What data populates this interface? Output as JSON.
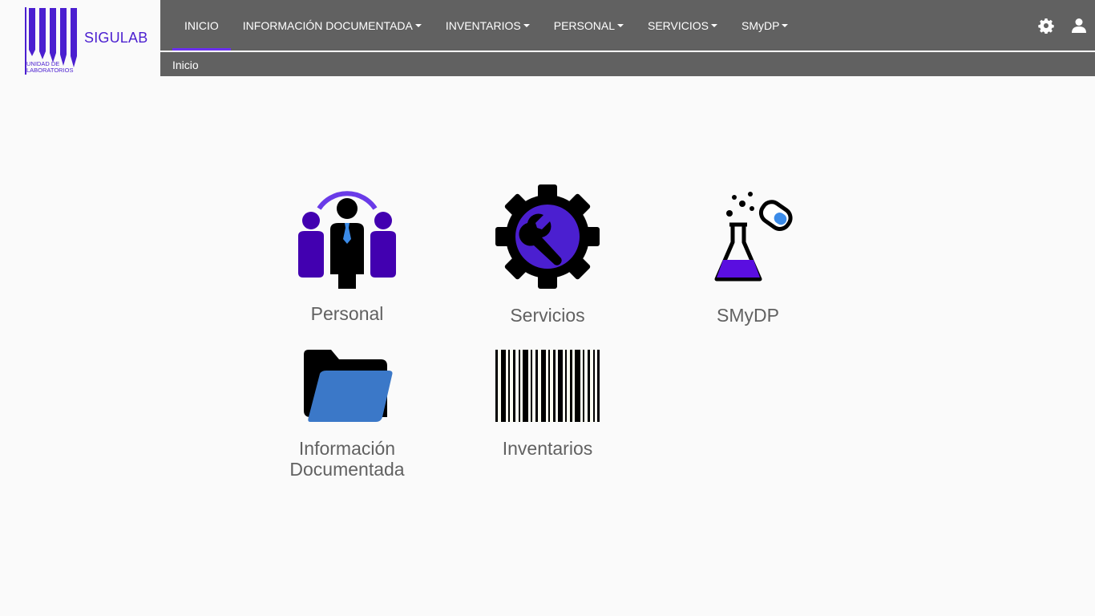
{
  "brand": {
    "name": "SIGULAB",
    "subtitle": "UNIDAD DE LABORATORIOS",
    "color": "#4b1fd0"
  },
  "nav": {
    "items": [
      {
        "label": "INICIO",
        "active": true,
        "dropdown": false
      },
      {
        "label": "INFORMACIÓN DOCUMENTADA",
        "active": false,
        "dropdown": true
      },
      {
        "label": "INVENTARIOS",
        "active": false,
        "dropdown": true
      },
      {
        "label": "PERSONAL",
        "active": false,
        "dropdown": true
      },
      {
        "label": "SERVICIOS",
        "active": false,
        "dropdown": true
      },
      {
        "label": "SMyDP",
        "active": false,
        "dropdown": true
      }
    ],
    "icons": [
      "gear-icon",
      "user-icon"
    ],
    "background": "#616161",
    "accent": "#6b2ff0"
  },
  "breadcrumb": {
    "current": "Inicio"
  },
  "tiles": {
    "personal": {
      "label": "Personal",
      "icon": "people-icon"
    },
    "servicios": {
      "label": "Servicios",
      "icon": "gear-wrench-icon"
    },
    "smydp": {
      "label": "SMyDP",
      "icon": "flask-test-tube-icon"
    },
    "informacion": {
      "label": "Información Documentada",
      "icon": "folder-icon"
    },
    "inventarios": {
      "label": "Inventarios",
      "icon": "barcode-icon"
    }
  }
}
